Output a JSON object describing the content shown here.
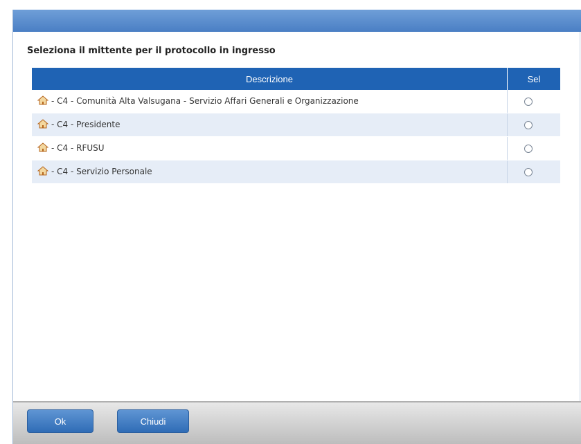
{
  "dialog": {
    "heading": "Seleziona il mittente per il protocollo in ingresso"
  },
  "table": {
    "columns": [
      "Descrizione",
      "Sel"
    ],
    "rows": [
      {
        "description": "- C4 - Comunità Alta Valsugana - Servizio Affari Generali e Organizzazione",
        "icon": "house-icon",
        "selected": false
      },
      {
        "description": "- C4 - Presidente",
        "icon": "house-icon",
        "selected": false
      },
      {
        "description": "- C4 - RFUSU",
        "icon": "house-icon",
        "selected": false
      },
      {
        "description": "- C4 - Servizio Personale",
        "icon": "house-icon",
        "selected": false
      }
    ]
  },
  "footer": {
    "ok_label": "Ok",
    "close_label": "Chiudi"
  },
  "colors": {
    "header_blue": "#1f63b4",
    "titlebar_blue": "#5a8fd0",
    "alt_row": "#e6edf7"
  }
}
